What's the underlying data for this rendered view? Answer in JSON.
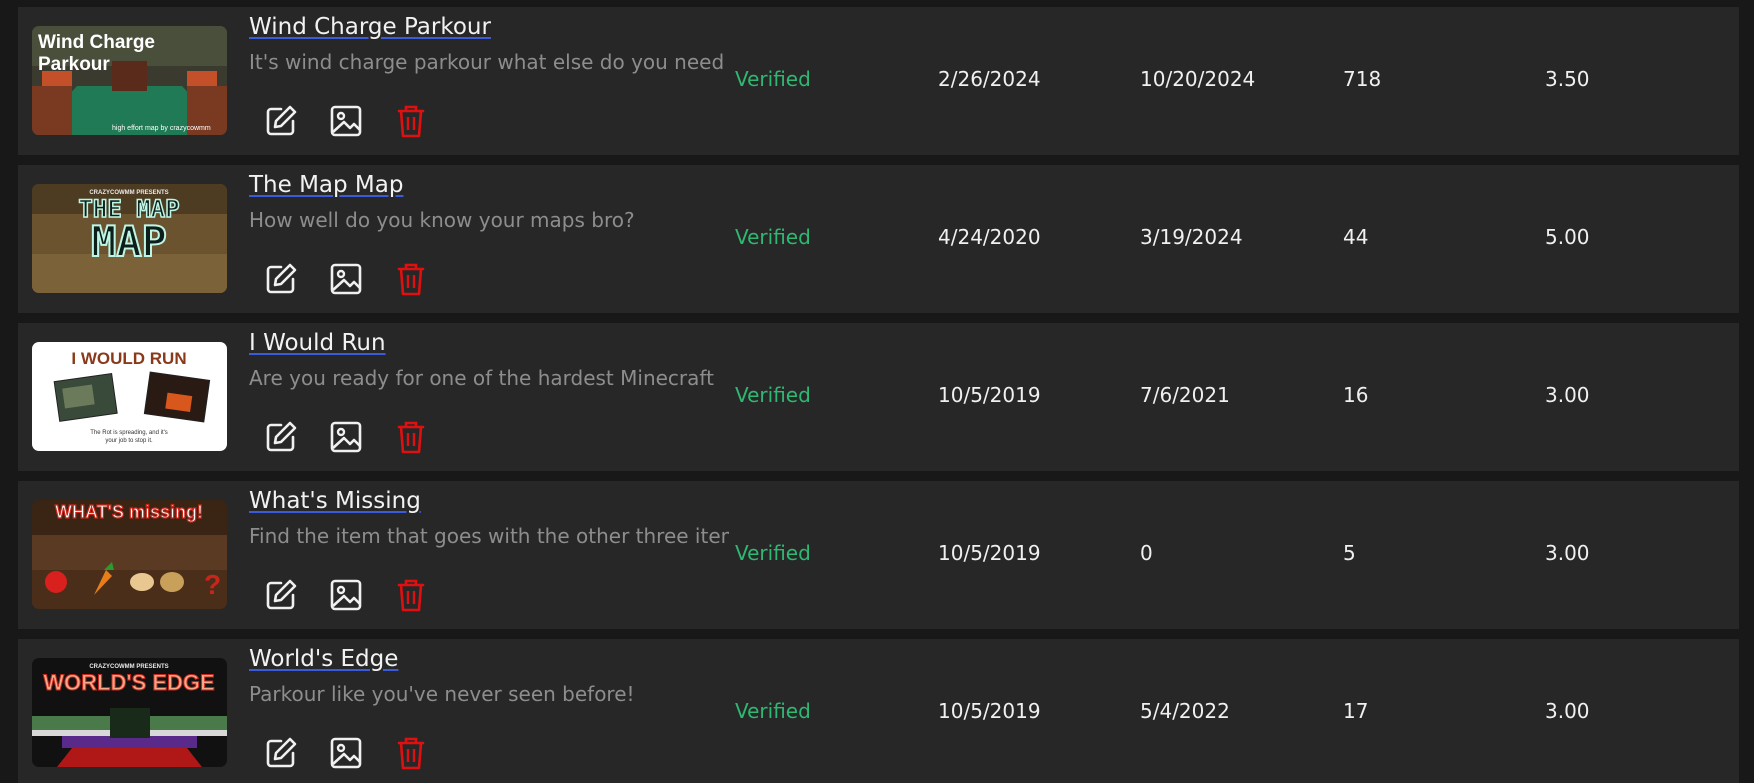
{
  "colors": {
    "row_background": "#272727",
    "page_background": "#181818",
    "verified": "#2fb872",
    "delete_icon": "#e01010",
    "title_underline": "#3b5bdb"
  },
  "rows": [
    {
      "title": "Wind Charge Parkour",
      "description": "It's wind charge parkour what else do you need",
      "status": "Verified",
      "published": "2/26/2024",
      "updated": "10/20/2024",
      "downloads": "718",
      "rating": "3.50",
      "thumb_text": [
        "Wind Charge",
        "Parkour",
        "high effort map by crazycowmm"
      ]
    },
    {
      "title": "The Map Map",
      "description": "How well do you know your maps bro?",
      "status": "Verified",
      "published": "4/24/2020",
      "updated": "3/19/2024",
      "downloads": "44",
      "rating": "5.00",
      "thumb_text": [
        "CRAZYCOWMM PRESENTS",
        "THE MAP",
        "MAP"
      ]
    },
    {
      "title": "I Would Run",
      "description": "Are you ready for one of the hardest Minecraft",
      "status": "Verified",
      "published": "10/5/2019",
      "updated": "7/6/2021",
      "downloads": "16",
      "rating": "3.00",
      "thumb_text": [
        "I WOULD RUN",
        "The Rot is spreading, and it's",
        "your job to stop it."
      ]
    },
    {
      "title": "What's Missing",
      "description": "Find the item that goes with the other three items",
      "status": "Verified",
      "published": "10/5/2019",
      "updated": "0",
      "downloads": "5",
      "rating": "3.00",
      "thumb_text": [
        "WHAT'S missing!",
        "?"
      ]
    },
    {
      "title": "World's Edge",
      "description": "Parkour like you've never seen before!",
      "status": "Verified",
      "published": "10/5/2019",
      "updated": "5/4/2022",
      "downloads": "17",
      "rating": "3.00",
      "thumb_text": [
        "CRAZYCOWMM PRESENTS",
        "WORLD'S EDGE"
      ]
    }
  ],
  "actions": {
    "edit_icon": "pencil-square-icon",
    "image_icon": "image-icon",
    "delete_icon": "trash-icon"
  }
}
